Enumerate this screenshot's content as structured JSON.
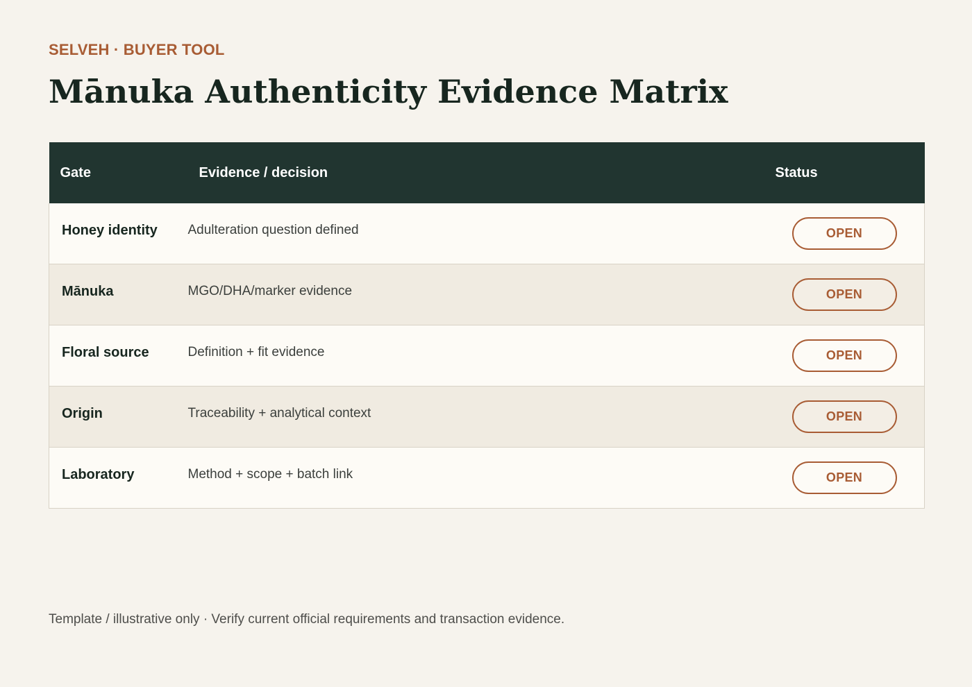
{
  "header": {
    "eyebrow": "SELVEH · BUYER TOOL",
    "title": "Mānuka Authenticity Evidence Matrix"
  },
  "table": {
    "columns": {
      "gate": "Gate",
      "evidence": "Evidence / decision",
      "status": "Status"
    },
    "rows": [
      {
        "gate": "Honey identity",
        "evidence": "Adulteration question defined",
        "status": "OPEN"
      },
      {
        "gate": "Mānuka",
        "evidence": "MGO/DHA/marker evidence",
        "status": "OPEN"
      },
      {
        "gate": "Floral source",
        "evidence": "Definition + fit evidence",
        "status": "OPEN"
      },
      {
        "gate": "Origin",
        "evidence": "Traceability + analytical context",
        "status": "OPEN"
      },
      {
        "gate": "Laboratory",
        "evidence": "Method + scope + batch link",
        "status": "OPEN"
      }
    ]
  },
  "footer": {
    "note": "Template / illustrative only · Verify current official requirements and transaction evidence."
  },
  "colors": {
    "accent": "#a85c34",
    "header_bg": "#213530",
    "page_bg": "#f6f3ed",
    "row_light": "#fdfbf6",
    "row_shaded": "#f0ebe1"
  }
}
